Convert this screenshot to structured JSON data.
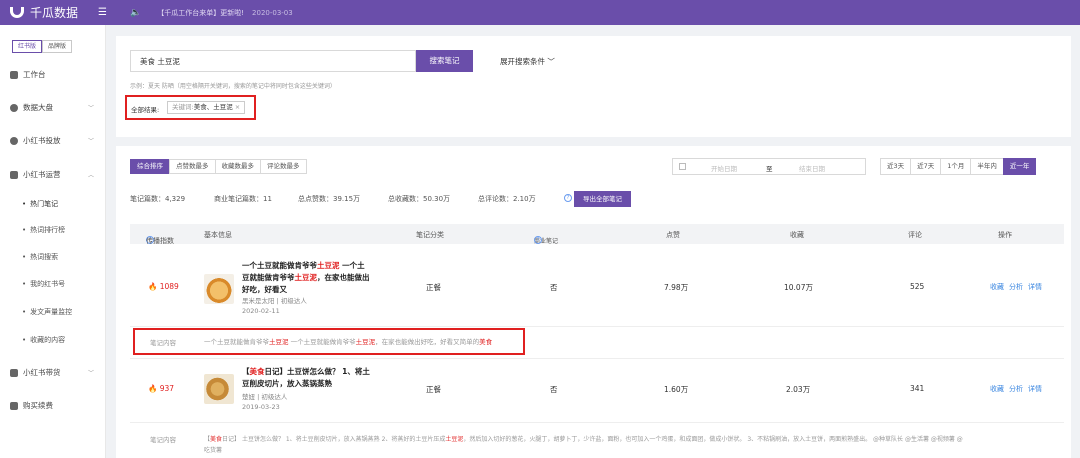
{
  "header": {
    "brand": "千瓜数据",
    "menu_icon": "menu-icon",
    "speaker_icon": "speaker-icon",
    "notice": "【千瓜工作台来单】更新啦!",
    "notice_date": "2020-03-03"
  },
  "sidebar": {
    "version_tabs": [
      "红书版",
      "品牌版"
    ],
    "items": [
      {
        "label": "工作台",
        "icon": "grid-icon"
      },
      {
        "label": "数据大盘",
        "icon": "pie-icon"
      },
      {
        "label": "小红书投放",
        "icon": "target-icon"
      },
      {
        "label": "小红书运营",
        "icon": "book-icon"
      },
      {
        "label": "小红书带货",
        "icon": "bag-icon"
      },
      {
        "label": "购买续费",
        "icon": "cart-icon"
      }
    ],
    "sub_items": [
      "热门笔记",
      "热词排行榜",
      "热词搜索",
      "我的红书号",
      "发文声量监控",
      "收藏的内容"
    ]
  },
  "search": {
    "value": "美食 土豆泥",
    "button": "搜索笔记",
    "expand": "展开搜索条件",
    "hint": "示例：夏天 防晒（用空格隔开关键词，搜索的笔记中将同时包含这些关键词）",
    "result_label": "全部结果:",
    "tag_key": "关键词:",
    "tag_value": "美食、土豆泥",
    "tag_close": "×"
  },
  "toolbar": {
    "sorts": [
      "综合排序",
      "点赞数最多",
      "收藏数最多",
      "评论数最多"
    ],
    "date_start": "开始日期",
    "date_to": "至",
    "date_end": "结束日期",
    "ranges": [
      "近3天",
      "近7天",
      "1个月",
      "半年内",
      "近一年"
    ]
  },
  "stats": {
    "notes": "笔记篇数：4,329",
    "business": "商业笔记篇数：11",
    "likes": "总点赞数：39.15万",
    "favs": "总收藏数：50.30万",
    "comments": "总评论数：2.10万",
    "export": "导出全部笔记"
  },
  "table": {
    "headers": [
      "传播指数",
      "基本信息",
      "笔记分类",
      "商业笔记",
      "点赞",
      "收藏",
      "评论",
      "操作"
    ],
    "rows": [
      {
        "hot": "1089",
        "title_a": "一个土豆就能做肯爷爷",
        "kw1": "土豆泥",
        "title_b": "一个土豆就能做肯爷爷",
        "kw2": "土豆泥",
        "title_c": "，在家也能做出好吃，好看又",
        "author": "黑米是太阳 | 初级达人",
        "date": "2020-02-11",
        "category": "正餐",
        "business": "否",
        "likes": "7.98万",
        "favs": "10.07万",
        "comments": "525",
        "ops": [
          "收藏",
          "分析",
          "详情"
        ],
        "content_label": "笔记内容",
        "content_a": "一个土豆就能做肯爷爷",
        "ckw1": "土豆泥",
        "content_b": " 一个土豆就能做肯爷爷",
        "ckw2": "土豆泥",
        "content_c": "，在家也能做出好吃，好看又简单的",
        "ckw3": "美食"
      },
      {
        "hot": "937",
        "title_pre": "【",
        "kw1": "美食",
        "title_a": "日记】土豆饼怎么做？ 1、将土豆削皮切片，放入蒸锅蒸熟",
        "author": "楚妞 | 初级达人",
        "date": "2019-03-23",
        "category": "正餐",
        "business": "否",
        "likes": "1.60万",
        "favs": "2.03万",
        "comments": "341",
        "ops": [
          "收藏",
          "分析",
          "详情"
        ],
        "content_label": "笔记内容",
        "content_pre": "【",
        "ckw1": "美食",
        "content_a": "日记】 土豆饼怎么做？ 1、将土豆削皮切片，放入蒸锅蒸熟 2、将蒸好的土豆片压成",
        "ckw2": "土豆泥",
        "content_b": "，然后加入切好的葱花，火腿丁，胡萝卜丁，少许盐，面粉，也可加入一个鸡蛋，和成面团，做成小饼状。 3、不粘锅刷油，放入土豆饼，两面煎熟盛出。 @种草队长 @生活薯 @视频薯 @",
        "content_c": "吃货薯"
      }
    ]
  },
  "colors": {
    "primary": "#6a4eaa",
    "highlight": "#e02020",
    "link": "#3a86e0"
  }
}
